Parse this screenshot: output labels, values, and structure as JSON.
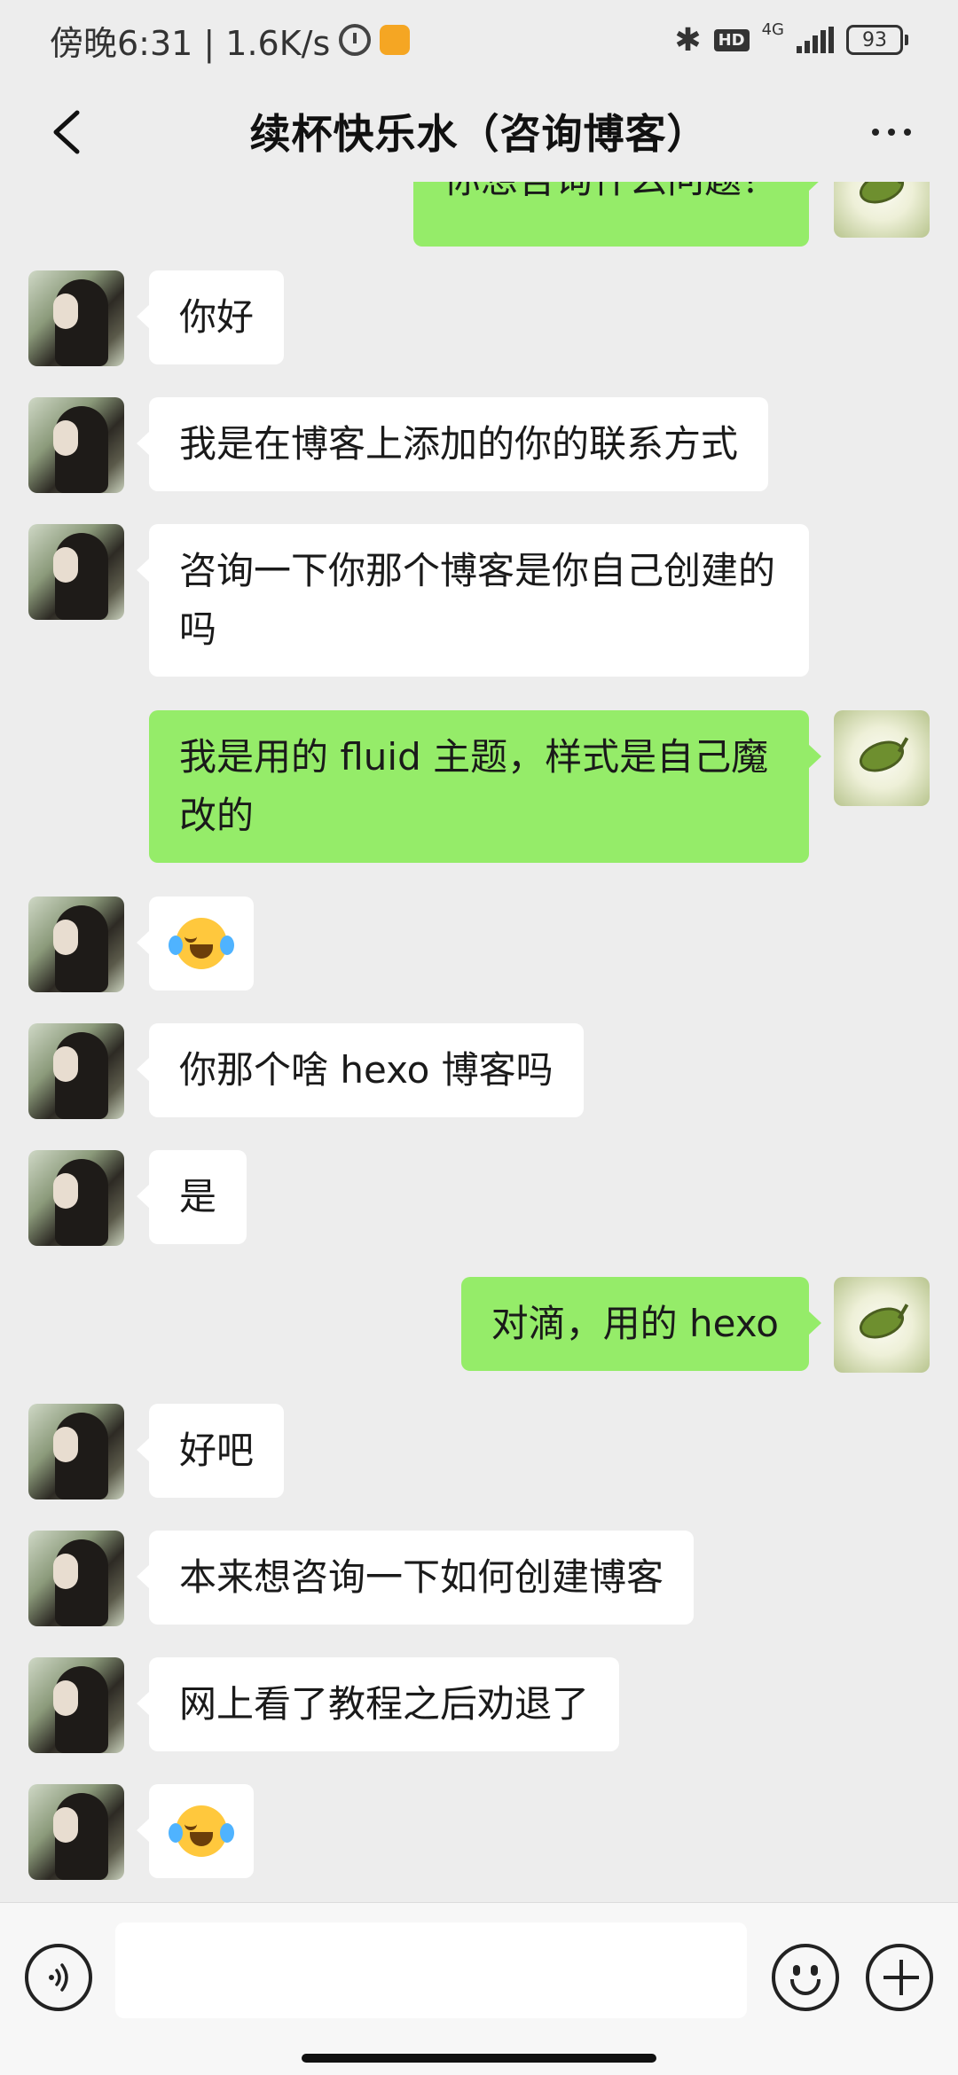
{
  "status_bar": {
    "time_text": "傍晚6:31 | 1.6K/s",
    "network_label": "4G",
    "hd_label": "HD",
    "battery_level": "93"
  },
  "header": {
    "title": "续杯快乐水（咨询博客）"
  },
  "messages": [
    {
      "sender": "self",
      "text": "你想咨询什么问题？"
    },
    {
      "sender": "other",
      "text": "你好"
    },
    {
      "sender": "other",
      "text": "我是在博客上添加的你的联系方式"
    },
    {
      "sender": "other",
      "text": "咨询一下你那个博客是你自己创建的吗"
    },
    {
      "sender": "self",
      "text": "我是用的 fluid 主题，样式是自己魔改的"
    },
    {
      "sender": "other",
      "emoji": "face-with-tears-of-joy"
    },
    {
      "sender": "other",
      "text": "你那个啥 hexo 博客吗"
    },
    {
      "sender": "other",
      "text": "是"
    },
    {
      "sender": "self",
      "text": "对滴，用的 hexo"
    },
    {
      "sender": "other",
      "text": "好吧"
    },
    {
      "sender": "other",
      "text": "本来想咨询一下如何创建博客"
    },
    {
      "sender": "other",
      "text": "网上看了教程之后劝退了"
    },
    {
      "sender": "other",
      "emoji": "face-with-tears-of-joy"
    }
  ],
  "input_bar": {
    "message_value": ""
  },
  "colors": {
    "background": "#ededed",
    "self_bubble": "#95ec69",
    "other_bubble": "#ffffff"
  }
}
